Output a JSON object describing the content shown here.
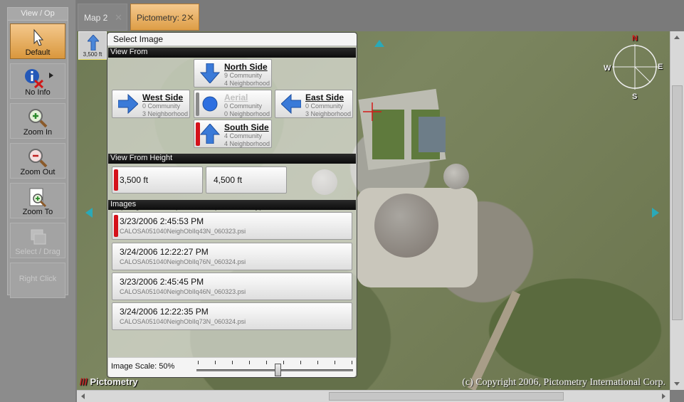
{
  "toolbox": {
    "title": "View / Op",
    "tools": [
      {
        "label": "Default",
        "icon": "cursor-icon",
        "state": "active"
      },
      {
        "label": "No Info",
        "icon": "info-no-icon",
        "state": "normal"
      },
      {
        "label": "Zoom In",
        "icon": "zoom-in-icon",
        "state": "normal"
      },
      {
        "label": "Zoom Out",
        "icon": "zoom-out-icon",
        "state": "normal"
      },
      {
        "label": "Zoom To",
        "icon": "zoom-to-icon",
        "state": "normal"
      },
      {
        "label": "Select / Drag",
        "icon": "select-drag-icon",
        "state": "disabled"
      },
      {
        "label": "Right Click",
        "icon": "",
        "state": "disabled"
      }
    ]
  },
  "tabs": [
    {
      "label": "Map 2",
      "close": "✕",
      "active": false
    },
    {
      "label": "Pictometry:  2",
      "close": "✕",
      "active": true
    }
  ],
  "scale_button": {
    "label": "3,500 ft"
  },
  "select_image": {
    "title": "Select Image",
    "view_from": {
      "header": "View From",
      "north": {
        "name": "North Side",
        "line1": "9 Community",
        "line2": "4 Neighborhood"
      },
      "west": {
        "name": "West Side",
        "line1": "0 Community",
        "line2": "3 Neighborhood"
      },
      "aerial": {
        "name": "Aerial",
        "line1": "0 Community",
        "line2": "0 Neighborhood"
      },
      "east": {
        "name": "East Side",
        "line1": "0 Community",
        "line2": "3 Neighborhood"
      },
      "south": {
        "name": "South Side",
        "line1": "4 Community",
        "line2": "4 Neighborhood"
      }
    },
    "view_from_height": {
      "header": "View From Height",
      "options": [
        "3,500 ft (Neighborhood)",
        "4,500 ft (Community)"
      ]
    },
    "images": {
      "header": "Images",
      "items": [
        {
          "date": "3/23/2006 2:45:53 PM",
          "file": "CALOSA051040NeighOblIq43N_060323.psi",
          "selected": true
        },
        {
          "date": "3/24/2006 12:22:27 PM",
          "file": "CALOSA051040NeighOblIq76N_060324.psi",
          "selected": false
        },
        {
          "date": "3/23/2006 2:45:45 PM",
          "file": "CALOSA051040NeighOblIq46N_060323.psi",
          "selected": false
        },
        {
          "date": "3/24/2006 12:22:35 PM",
          "file": "CALOSA051040NeighOblIq73N_060324.psi",
          "selected": false
        }
      ]
    },
    "image_scale": {
      "label": "Image Scale:",
      "value": "50%",
      "fraction": 0.5
    }
  },
  "map": {
    "copyright": "(c) Copyright 2006, Pictometry International Corp.",
    "logo": "Pictometry",
    "compass": {
      "n": "N",
      "e": "E",
      "s": "S",
      "w": "W"
    }
  },
  "colors": {
    "accent": "#dd9d46",
    "selected": "#d4111a",
    "arrow": "#2a6fd6"
  }
}
